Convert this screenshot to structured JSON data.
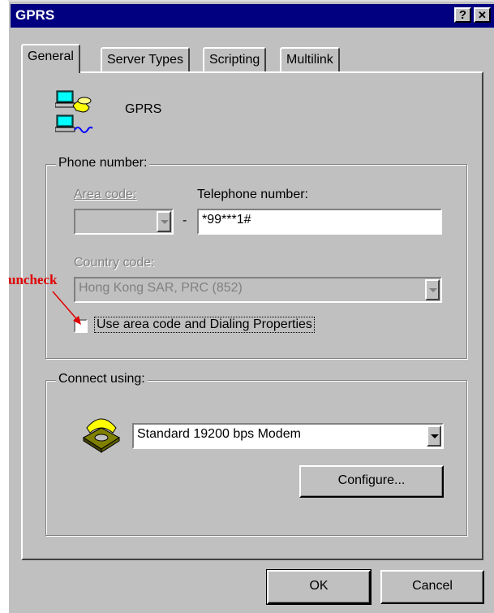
{
  "window": {
    "title": "GPRS",
    "help_btn": "?",
    "close_btn": "✕"
  },
  "tabs": [
    {
      "label": "General",
      "active": true
    },
    {
      "label": "Server Types",
      "active": false
    },
    {
      "label": "Scripting",
      "active": false
    },
    {
      "label": "Multilink",
      "active": false
    }
  ],
  "connection": {
    "name": "GPRS",
    "icon": "dialup-computer-phone-icon"
  },
  "phone_group": {
    "legend": "Phone number:",
    "area_code_label": "Area code:",
    "area_code_value": "",
    "dash": "-",
    "telephone_label": "Telephone number:",
    "telephone_value": "*99***1#",
    "country_code_label": "Country code:",
    "country_code_value": "Hong Kong SAR, PRC (852)",
    "use_area_code_label": "Use area code and Dialing Properties",
    "use_area_code_checked": false
  },
  "connect_group": {
    "legend": "Connect using:",
    "modem_icon": "modem-phone-icon",
    "device": "Standard 19200 bps Modem",
    "configure_label": "Configure..."
  },
  "footer": {
    "ok_label": "OK",
    "cancel_label": "Cancel"
  },
  "annotation": {
    "text": "uncheck",
    "color": "#e00000"
  }
}
